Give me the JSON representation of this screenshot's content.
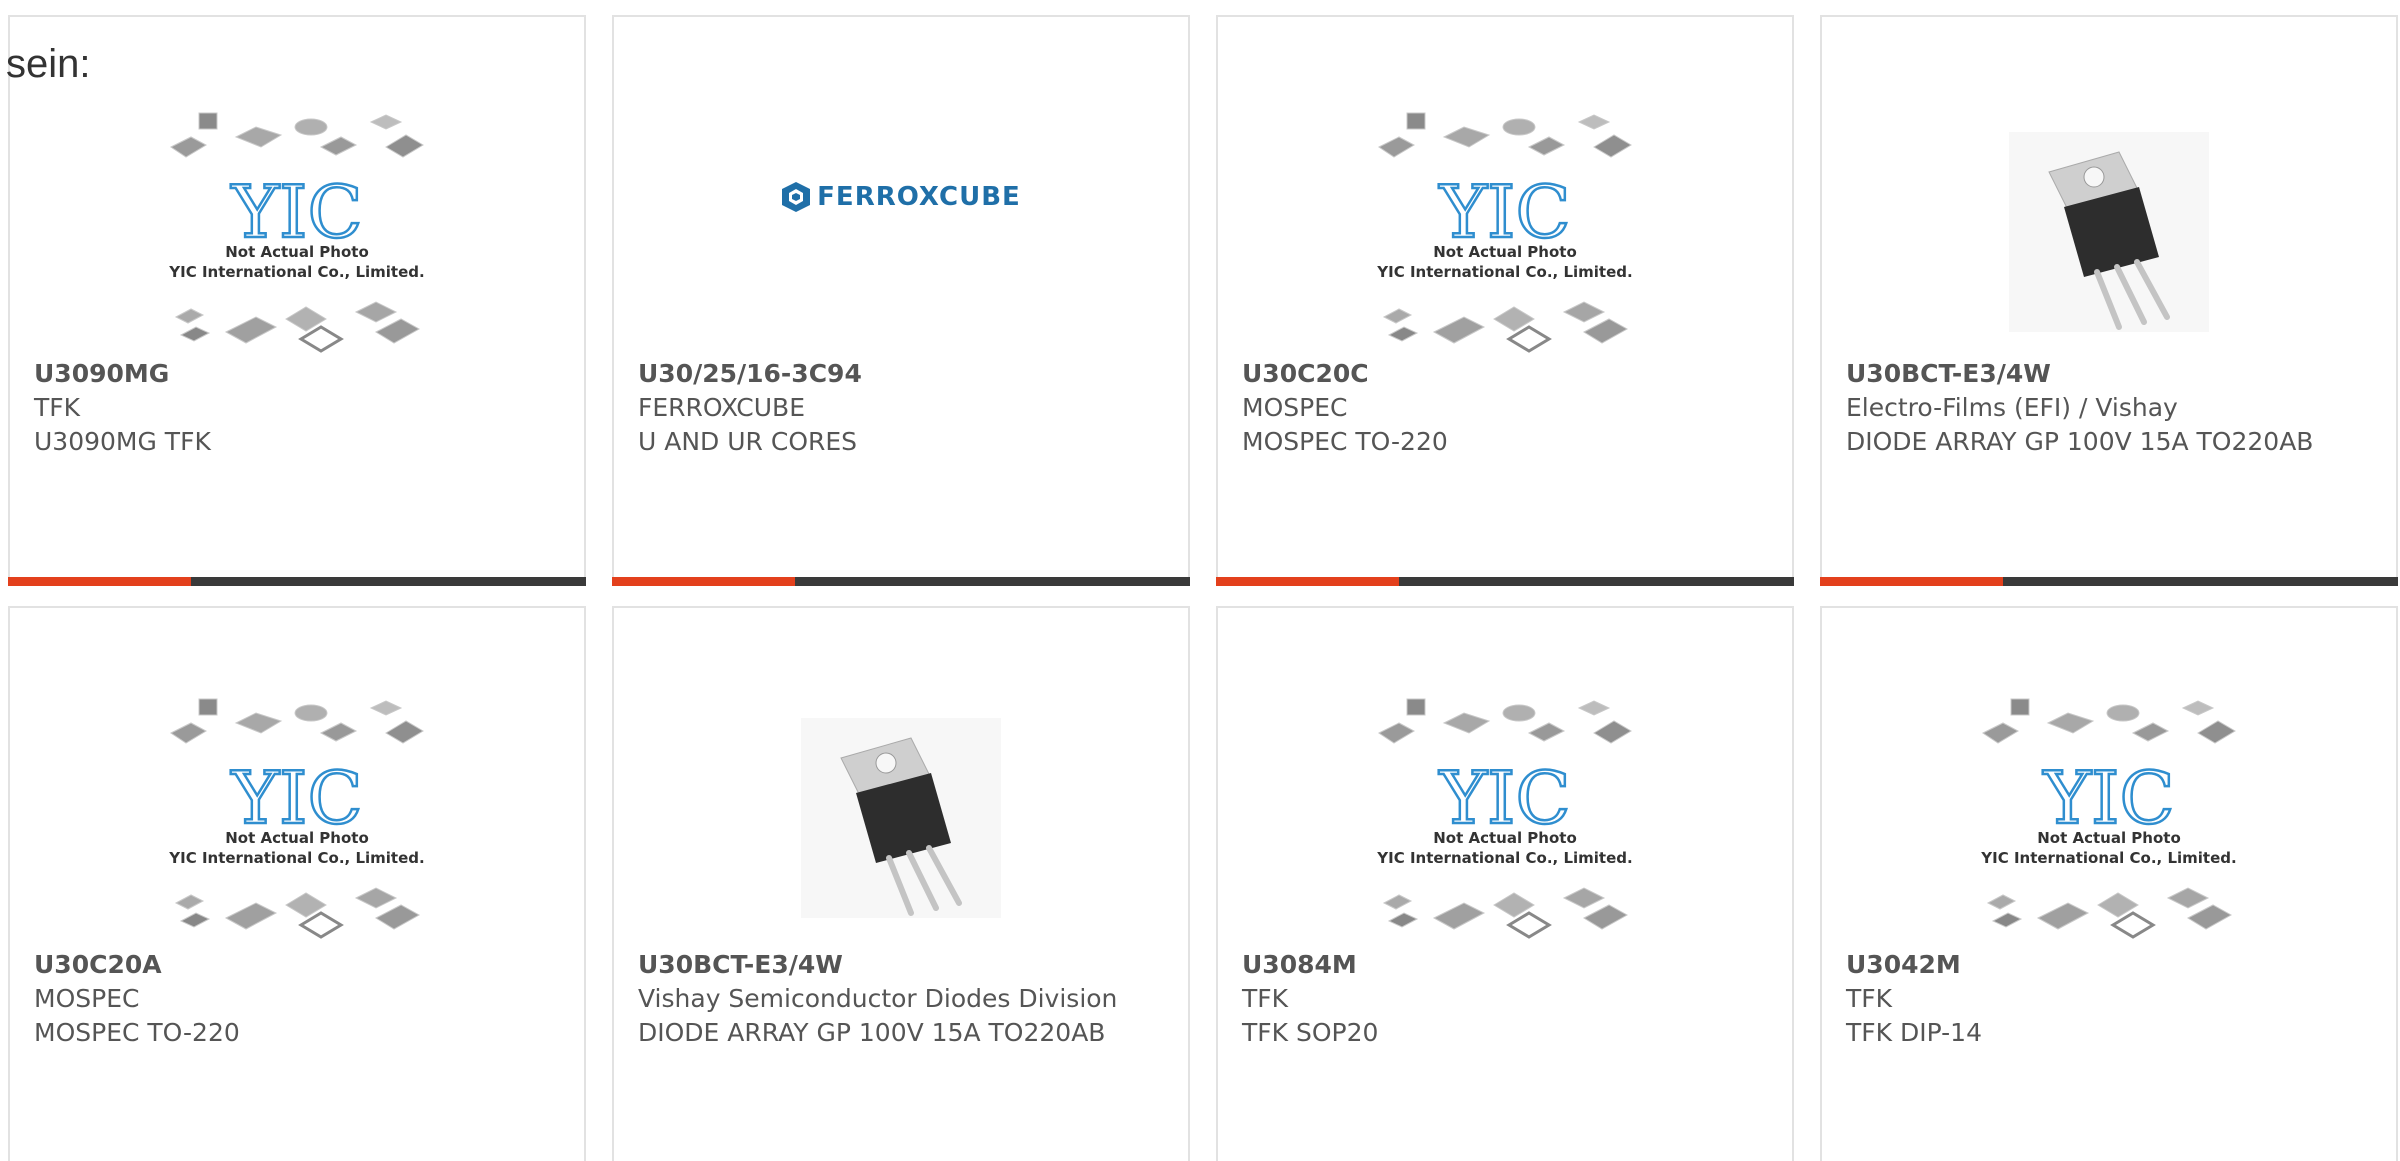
{
  "intro_text": "sein:",
  "placeholder": {
    "logo_text": "YIC",
    "line1": "Not Actual Photo",
    "line2": "YIC International Co., Limited."
  },
  "ferroxcube_logo": "FERROXCUBE",
  "colors": {
    "accent": "#e3401c",
    "bar": "#3a3a3a",
    "border": "#e2e2e2",
    "text": "#555555"
  },
  "products": [
    {
      "part": "U3090MG",
      "manufacturer": "TFK",
      "description": "U3090MG TFK",
      "image": "placeholder"
    },
    {
      "part": "U30/25/16-3C94",
      "manufacturer": "FERROXCUBE",
      "description": "U AND UR CORES",
      "image": "ferroxcube-logo"
    },
    {
      "part": "U30C20C",
      "manufacturer": "MOSPEC",
      "description": "MOSPEC TO-220",
      "image": "placeholder"
    },
    {
      "part": "U30BCT-E3/4W",
      "manufacturer": "Electro-Films (EFI) / Vishay",
      "description": "DIODE ARRAY GP 100V 15A TO220AB",
      "image": "to220-package"
    },
    {
      "part": "U30C20A",
      "manufacturer": "MOSPEC",
      "description": "MOSPEC TO-220",
      "image": "placeholder"
    },
    {
      "part": "U30BCT-E3/4W",
      "manufacturer": "Vishay Semiconductor Diodes Division",
      "description": "DIODE ARRAY GP 100V 15A TO220AB",
      "image": "to220-package"
    },
    {
      "part": "U3084M",
      "manufacturer": "TFK",
      "description": "TFK SOP20",
      "image": "placeholder"
    },
    {
      "part": "U3042M",
      "manufacturer": "TFK",
      "description": "TFK DIP-14",
      "image": "placeholder"
    }
  ]
}
